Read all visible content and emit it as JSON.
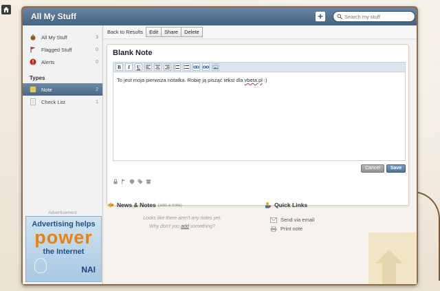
{
  "app": {
    "title": "All My Stuff"
  },
  "search": {
    "placeholder": "Search my stuff"
  },
  "sidebar": {
    "items": [
      {
        "label": "All My Stuff",
        "count": "3"
      },
      {
        "label": "Flagged Stuff",
        "count": "0"
      },
      {
        "label": "Alerts",
        "count": "0"
      }
    ],
    "types_heading": "Types",
    "types": [
      {
        "label": "Note",
        "count": "2"
      },
      {
        "label": "Check List",
        "count": "1"
      }
    ]
  },
  "toolbar": {
    "back_label": "Back to Results",
    "edit_label": "Edit",
    "share_label": "Share",
    "delete_label": "Delete"
  },
  "note": {
    "title": "Blank Note",
    "body_before": "To jest moja pierwsza notatka. Robię ją pisząc tekst dla ",
    "body_link": "vbeta.pl",
    "body_after": " :)",
    "cancel_label": "Cancel",
    "save_label": "Save"
  },
  "editor_buttons": [
    "B",
    "I",
    "U"
  ],
  "news": {
    "title": "News & Notes",
    "add_label": "(add a note)",
    "empty_line1": "Looks like there aren't any notes yet.",
    "empty_line2_before": "Why don't you ",
    "empty_line2_link": "add",
    "empty_line2_after": " something?"
  },
  "quick_links": {
    "title": "Quick Links",
    "items": [
      {
        "label": "Send via email",
        "icon": "email-icon"
      },
      {
        "label": "Print note",
        "icon": "print-icon"
      }
    ]
  },
  "ad": {
    "label": "Advertisement",
    "line1": "Advertising helps",
    "line2": "power",
    "line3": "the Internet",
    "logo": "NAI"
  },
  "colors": {
    "titlebar": "#45627f",
    "active_item": "#4c6888",
    "frame": "#8a6e4e",
    "save": "#4f7297"
  }
}
